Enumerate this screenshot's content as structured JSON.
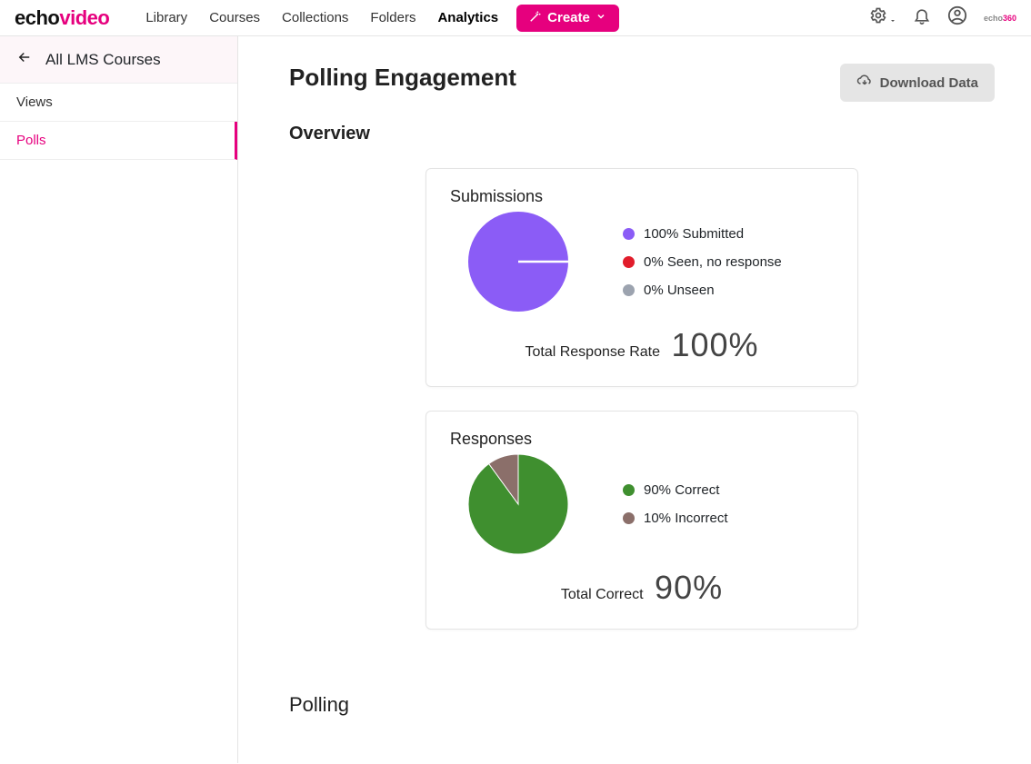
{
  "brand": {
    "part1": "echo",
    "part2": "video"
  },
  "nav": {
    "items": [
      "Library",
      "Courses",
      "Collections",
      "Folders",
      "Analytics"
    ],
    "activeIndex": 4,
    "create": "Create"
  },
  "sidebar": {
    "header": "All LMS Courses",
    "items": [
      "Views",
      "Polls"
    ],
    "activeIndex": 1
  },
  "page": {
    "title": "Polling Engagement",
    "download": "Download Data",
    "overview": "Overview",
    "polling": "Polling"
  },
  "cards": {
    "submissions": {
      "title": "Submissions",
      "summaryLabel": "Total Response Rate",
      "summaryValue": "100%"
    },
    "responses": {
      "title": "Responses",
      "summaryLabel": "Total Correct",
      "summaryValue": "90%"
    }
  },
  "colors": {
    "submitted": "#8b5cf6",
    "seenNoResponse": "#e11d2b",
    "unseen": "#9ca3af",
    "correct": "#3f8f2f",
    "incorrect": "#8b6f6a"
  },
  "chart_data": [
    {
      "type": "pie",
      "title": "Submissions",
      "series": [
        {
          "name": "Submitted",
          "value": 100,
          "label": "100% Submitted",
          "color": "#8b5cf6"
        },
        {
          "name": "Seen, no response",
          "value": 0,
          "label": "0% Seen, no response",
          "color": "#e11d2b"
        },
        {
          "name": "Unseen",
          "value": 0,
          "label": "0% Unseen",
          "color": "#9ca3af"
        }
      ],
      "summary": {
        "label": "Total Response Rate",
        "value": 100,
        "unit": "%"
      }
    },
    {
      "type": "pie",
      "title": "Responses",
      "series": [
        {
          "name": "Correct",
          "value": 90,
          "label": "90% Correct",
          "color": "#3f8f2f"
        },
        {
          "name": "Incorrect",
          "value": 10,
          "label": "10% Incorrect",
          "color": "#8b6f6a"
        }
      ],
      "summary": {
        "label": "Total Correct",
        "value": 90,
        "unit": "%"
      }
    }
  ]
}
